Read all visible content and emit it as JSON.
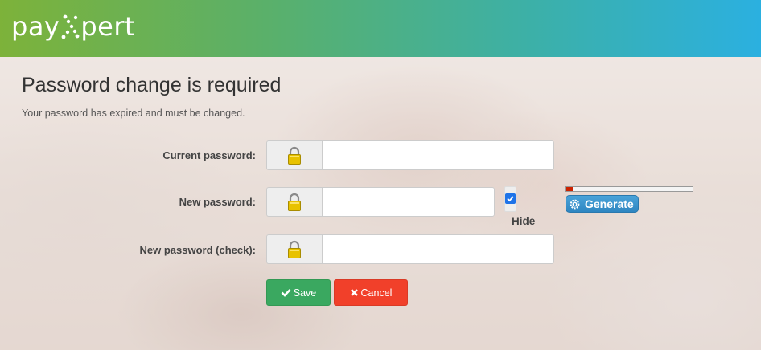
{
  "header": {
    "logo_left": "pay",
    "logo_right": "pert"
  },
  "page": {
    "title": "Password change is required",
    "subtitle": "Your password has expired and must be changed."
  },
  "form": {
    "current_password": {
      "label": "Current password:",
      "value": "",
      "icon": "lock-icon"
    },
    "new_password": {
      "label": "New password:",
      "value": "",
      "icon": "lock-icon"
    },
    "new_password_check": {
      "label": "New password (check):",
      "value": "",
      "icon": "lock-icon"
    },
    "hide": {
      "label": "Hide",
      "checked": true
    },
    "strength": {
      "level": 0.06,
      "color": "#cc2200"
    },
    "generate_label": "Generate",
    "save_label": "Save",
    "cancel_label": "Cancel"
  },
  "colors": {
    "header_gradient_start": "#7db23a",
    "header_gradient_end": "#2bb0e0",
    "save": "#3aa860",
    "cancel": "#f1402a",
    "generate": "#2e86c1"
  }
}
